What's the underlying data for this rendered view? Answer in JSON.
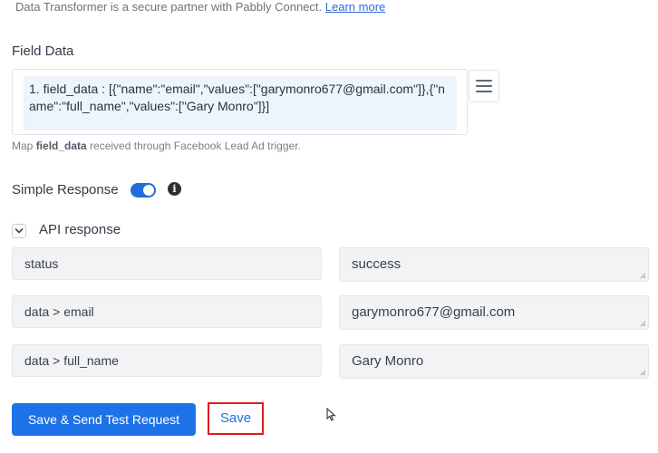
{
  "info": {
    "text": "Data Transformer is a secure partner with Pabbly Connect.",
    "link": "Learn more"
  },
  "field_data": {
    "label": "Field Data",
    "token": "1. field_data : [{\"name\":\"email\",\"values\":[\"garymonro677@gmail.com\"]},{\"name\":\"full_name\",\"values\":[\"Gary Monro\"]}]",
    "hint_prefix": "Map",
    "hint_bold": "field_data",
    "hint_suffix": "received through Facebook Lead Ad trigger.",
    "menu_icon": "hamburger-icon"
  },
  "simple_response": {
    "label": "Simple Response",
    "enabled": true,
    "info_icon": "info-icon"
  },
  "api_response": {
    "label": "API response",
    "expanded": true,
    "rows": [
      {
        "key": "status",
        "value": "success"
      },
      {
        "key": "data > email",
        "value": "garymonro677@gmail.com"
      },
      {
        "key": "data > full_name",
        "value": "Gary Monro"
      }
    ]
  },
  "actions": {
    "primary": "Save & Send Test Request",
    "save": "Save"
  },
  "colors": {
    "accent": "#1d72e8",
    "highlight_border": "#e01b1b"
  }
}
